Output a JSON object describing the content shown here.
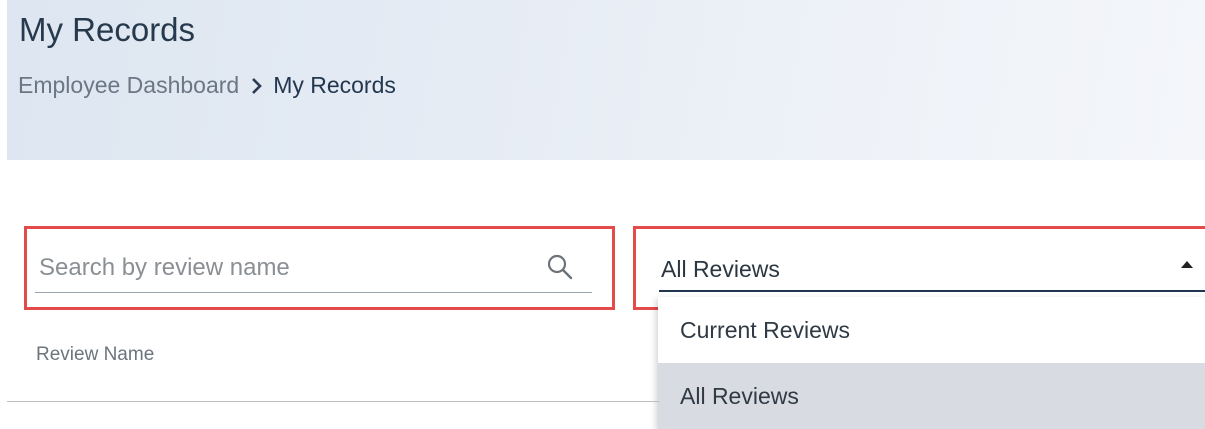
{
  "header": {
    "title": "My Records",
    "breadcrumb": {
      "parent": "Employee Dashboard",
      "current": "My Records"
    }
  },
  "search": {
    "placeholder": "Search by review name",
    "value": ""
  },
  "filter": {
    "selected": "All Reviews",
    "options": [
      "Current Reviews",
      "All Reviews"
    ]
  },
  "table": {
    "columns": [
      "Review Name"
    ]
  },
  "colors": {
    "highlight_border": "#e34b4b",
    "selected_option_bg": "#d8dce2",
    "title_text": "#273a4d"
  }
}
